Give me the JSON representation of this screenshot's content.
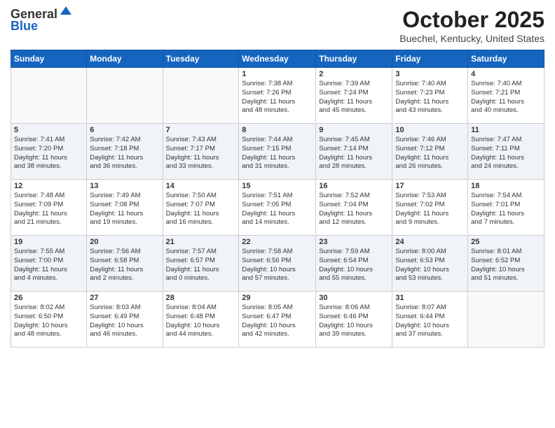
{
  "header": {
    "logo_line1": "General",
    "logo_line2": "Blue",
    "month_title": "October 2025",
    "location": "Buechel, Kentucky, United States"
  },
  "days_of_week": [
    "Sunday",
    "Monday",
    "Tuesday",
    "Wednesday",
    "Thursday",
    "Friday",
    "Saturday"
  ],
  "weeks": [
    [
      {
        "day": "",
        "info": ""
      },
      {
        "day": "",
        "info": ""
      },
      {
        "day": "",
        "info": ""
      },
      {
        "day": "1",
        "info": "Sunrise: 7:38 AM\nSunset: 7:26 PM\nDaylight: 11 hours\nand 48 minutes."
      },
      {
        "day": "2",
        "info": "Sunrise: 7:39 AM\nSunset: 7:24 PM\nDaylight: 11 hours\nand 45 minutes."
      },
      {
        "day": "3",
        "info": "Sunrise: 7:40 AM\nSunset: 7:23 PM\nDaylight: 11 hours\nand 43 minutes."
      },
      {
        "day": "4",
        "info": "Sunrise: 7:40 AM\nSunset: 7:21 PM\nDaylight: 11 hours\nand 40 minutes."
      }
    ],
    [
      {
        "day": "5",
        "info": "Sunrise: 7:41 AM\nSunset: 7:20 PM\nDaylight: 11 hours\nand 38 minutes."
      },
      {
        "day": "6",
        "info": "Sunrise: 7:42 AM\nSunset: 7:18 PM\nDaylight: 11 hours\nand 36 minutes."
      },
      {
        "day": "7",
        "info": "Sunrise: 7:43 AM\nSunset: 7:17 PM\nDaylight: 11 hours\nand 33 minutes."
      },
      {
        "day": "8",
        "info": "Sunrise: 7:44 AM\nSunset: 7:15 PM\nDaylight: 11 hours\nand 31 minutes."
      },
      {
        "day": "9",
        "info": "Sunrise: 7:45 AM\nSunset: 7:14 PM\nDaylight: 11 hours\nand 28 minutes."
      },
      {
        "day": "10",
        "info": "Sunrise: 7:46 AM\nSunset: 7:12 PM\nDaylight: 11 hours\nand 26 minutes."
      },
      {
        "day": "11",
        "info": "Sunrise: 7:47 AM\nSunset: 7:11 PM\nDaylight: 11 hours\nand 24 minutes."
      }
    ],
    [
      {
        "day": "12",
        "info": "Sunrise: 7:48 AM\nSunset: 7:09 PM\nDaylight: 11 hours\nand 21 minutes."
      },
      {
        "day": "13",
        "info": "Sunrise: 7:49 AM\nSunset: 7:08 PM\nDaylight: 11 hours\nand 19 minutes."
      },
      {
        "day": "14",
        "info": "Sunrise: 7:50 AM\nSunset: 7:07 PM\nDaylight: 11 hours\nand 16 minutes."
      },
      {
        "day": "15",
        "info": "Sunrise: 7:51 AM\nSunset: 7:05 PM\nDaylight: 11 hours\nand 14 minutes."
      },
      {
        "day": "16",
        "info": "Sunrise: 7:52 AM\nSunset: 7:04 PM\nDaylight: 11 hours\nand 12 minutes."
      },
      {
        "day": "17",
        "info": "Sunrise: 7:53 AM\nSunset: 7:02 PM\nDaylight: 11 hours\nand 9 minutes."
      },
      {
        "day": "18",
        "info": "Sunrise: 7:54 AM\nSunset: 7:01 PM\nDaylight: 11 hours\nand 7 minutes."
      }
    ],
    [
      {
        "day": "19",
        "info": "Sunrise: 7:55 AM\nSunset: 7:00 PM\nDaylight: 11 hours\nand 4 minutes."
      },
      {
        "day": "20",
        "info": "Sunrise: 7:56 AM\nSunset: 6:58 PM\nDaylight: 11 hours\nand 2 minutes."
      },
      {
        "day": "21",
        "info": "Sunrise: 7:57 AM\nSunset: 6:57 PM\nDaylight: 11 hours\nand 0 minutes."
      },
      {
        "day": "22",
        "info": "Sunrise: 7:58 AM\nSunset: 6:56 PM\nDaylight: 10 hours\nand 57 minutes."
      },
      {
        "day": "23",
        "info": "Sunrise: 7:59 AM\nSunset: 6:54 PM\nDaylight: 10 hours\nand 55 minutes."
      },
      {
        "day": "24",
        "info": "Sunrise: 8:00 AM\nSunset: 6:53 PM\nDaylight: 10 hours\nand 53 minutes."
      },
      {
        "day": "25",
        "info": "Sunrise: 8:01 AM\nSunset: 6:52 PM\nDaylight: 10 hours\nand 51 minutes."
      }
    ],
    [
      {
        "day": "26",
        "info": "Sunrise: 8:02 AM\nSunset: 6:50 PM\nDaylight: 10 hours\nand 48 minutes."
      },
      {
        "day": "27",
        "info": "Sunrise: 8:03 AM\nSunset: 6:49 PM\nDaylight: 10 hours\nand 46 minutes."
      },
      {
        "day": "28",
        "info": "Sunrise: 8:04 AM\nSunset: 6:48 PM\nDaylight: 10 hours\nand 44 minutes."
      },
      {
        "day": "29",
        "info": "Sunrise: 8:05 AM\nSunset: 6:47 PM\nDaylight: 10 hours\nand 42 minutes."
      },
      {
        "day": "30",
        "info": "Sunrise: 8:06 AM\nSunset: 6:46 PM\nDaylight: 10 hours\nand 39 minutes."
      },
      {
        "day": "31",
        "info": "Sunrise: 8:07 AM\nSunset: 6:44 PM\nDaylight: 10 hours\nand 37 minutes."
      },
      {
        "day": "",
        "info": ""
      }
    ]
  ]
}
